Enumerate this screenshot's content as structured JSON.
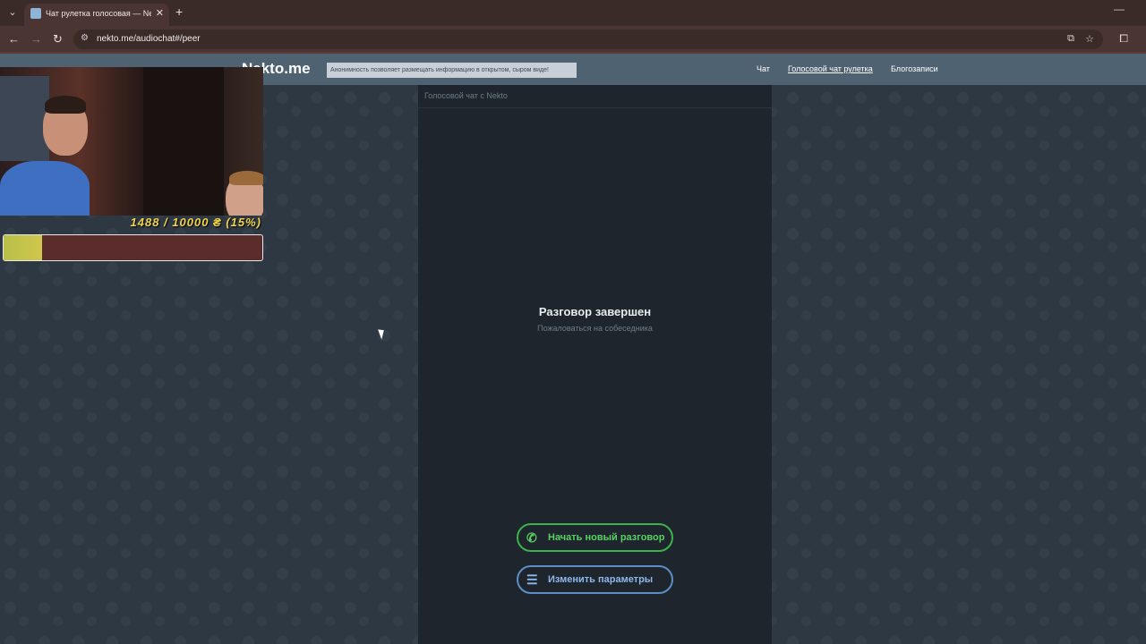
{
  "browser": {
    "tab_title": "Чат рулетка голосовая — Nekto",
    "url": "nekto.me/audiochat#/peer",
    "icons": {
      "tab_menu": "chevron-down-icon",
      "close": "close-icon",
      "new_tab": "plus-icon",
      "back": "arrow-left-icon",
      "forward": "arrow-right-icon",
      "reload": "reload-icon",
      "site_info": "tune-icon",
      "install": "install-app-icon",
      "bookmark": "star-icon",
      "extensions": "puzzle-icon",
      "minimize": "minimize-icon"
    }
  },
  "site": {
    "logo": "Nekto.me",
    "notice": "Анонимность позволяет размещать информацию в открытом, сыром виде!",
    "nav": {
      "chat": "Чат",
      "voice_roulette": "Голосовой чат рулетка",
      "blog": "Блогозаписи"
    }
  },
  "panel": {
    "header": "Голосовой чат с Nekto",
    "status_title": "Разговор завершен",
    "report_link": "Пожаловаться на собеседника",
    "buttons": {
      "new_conversation": "Начать новый разговор",
      "change_params": "Изменить параметры"
    }
  },
  "overlay": {
    "donation_text": "1488 / 10000 ₴ (15%)",
    "donation_progress": 0.15
  },
  "colors": {
    "accent_green": "#3cb34a",
    "accent_blue": "#5a8fc8",
    "header_bg": "#4f6272",
    "panel_bg": "#1e252d"
  }
}
